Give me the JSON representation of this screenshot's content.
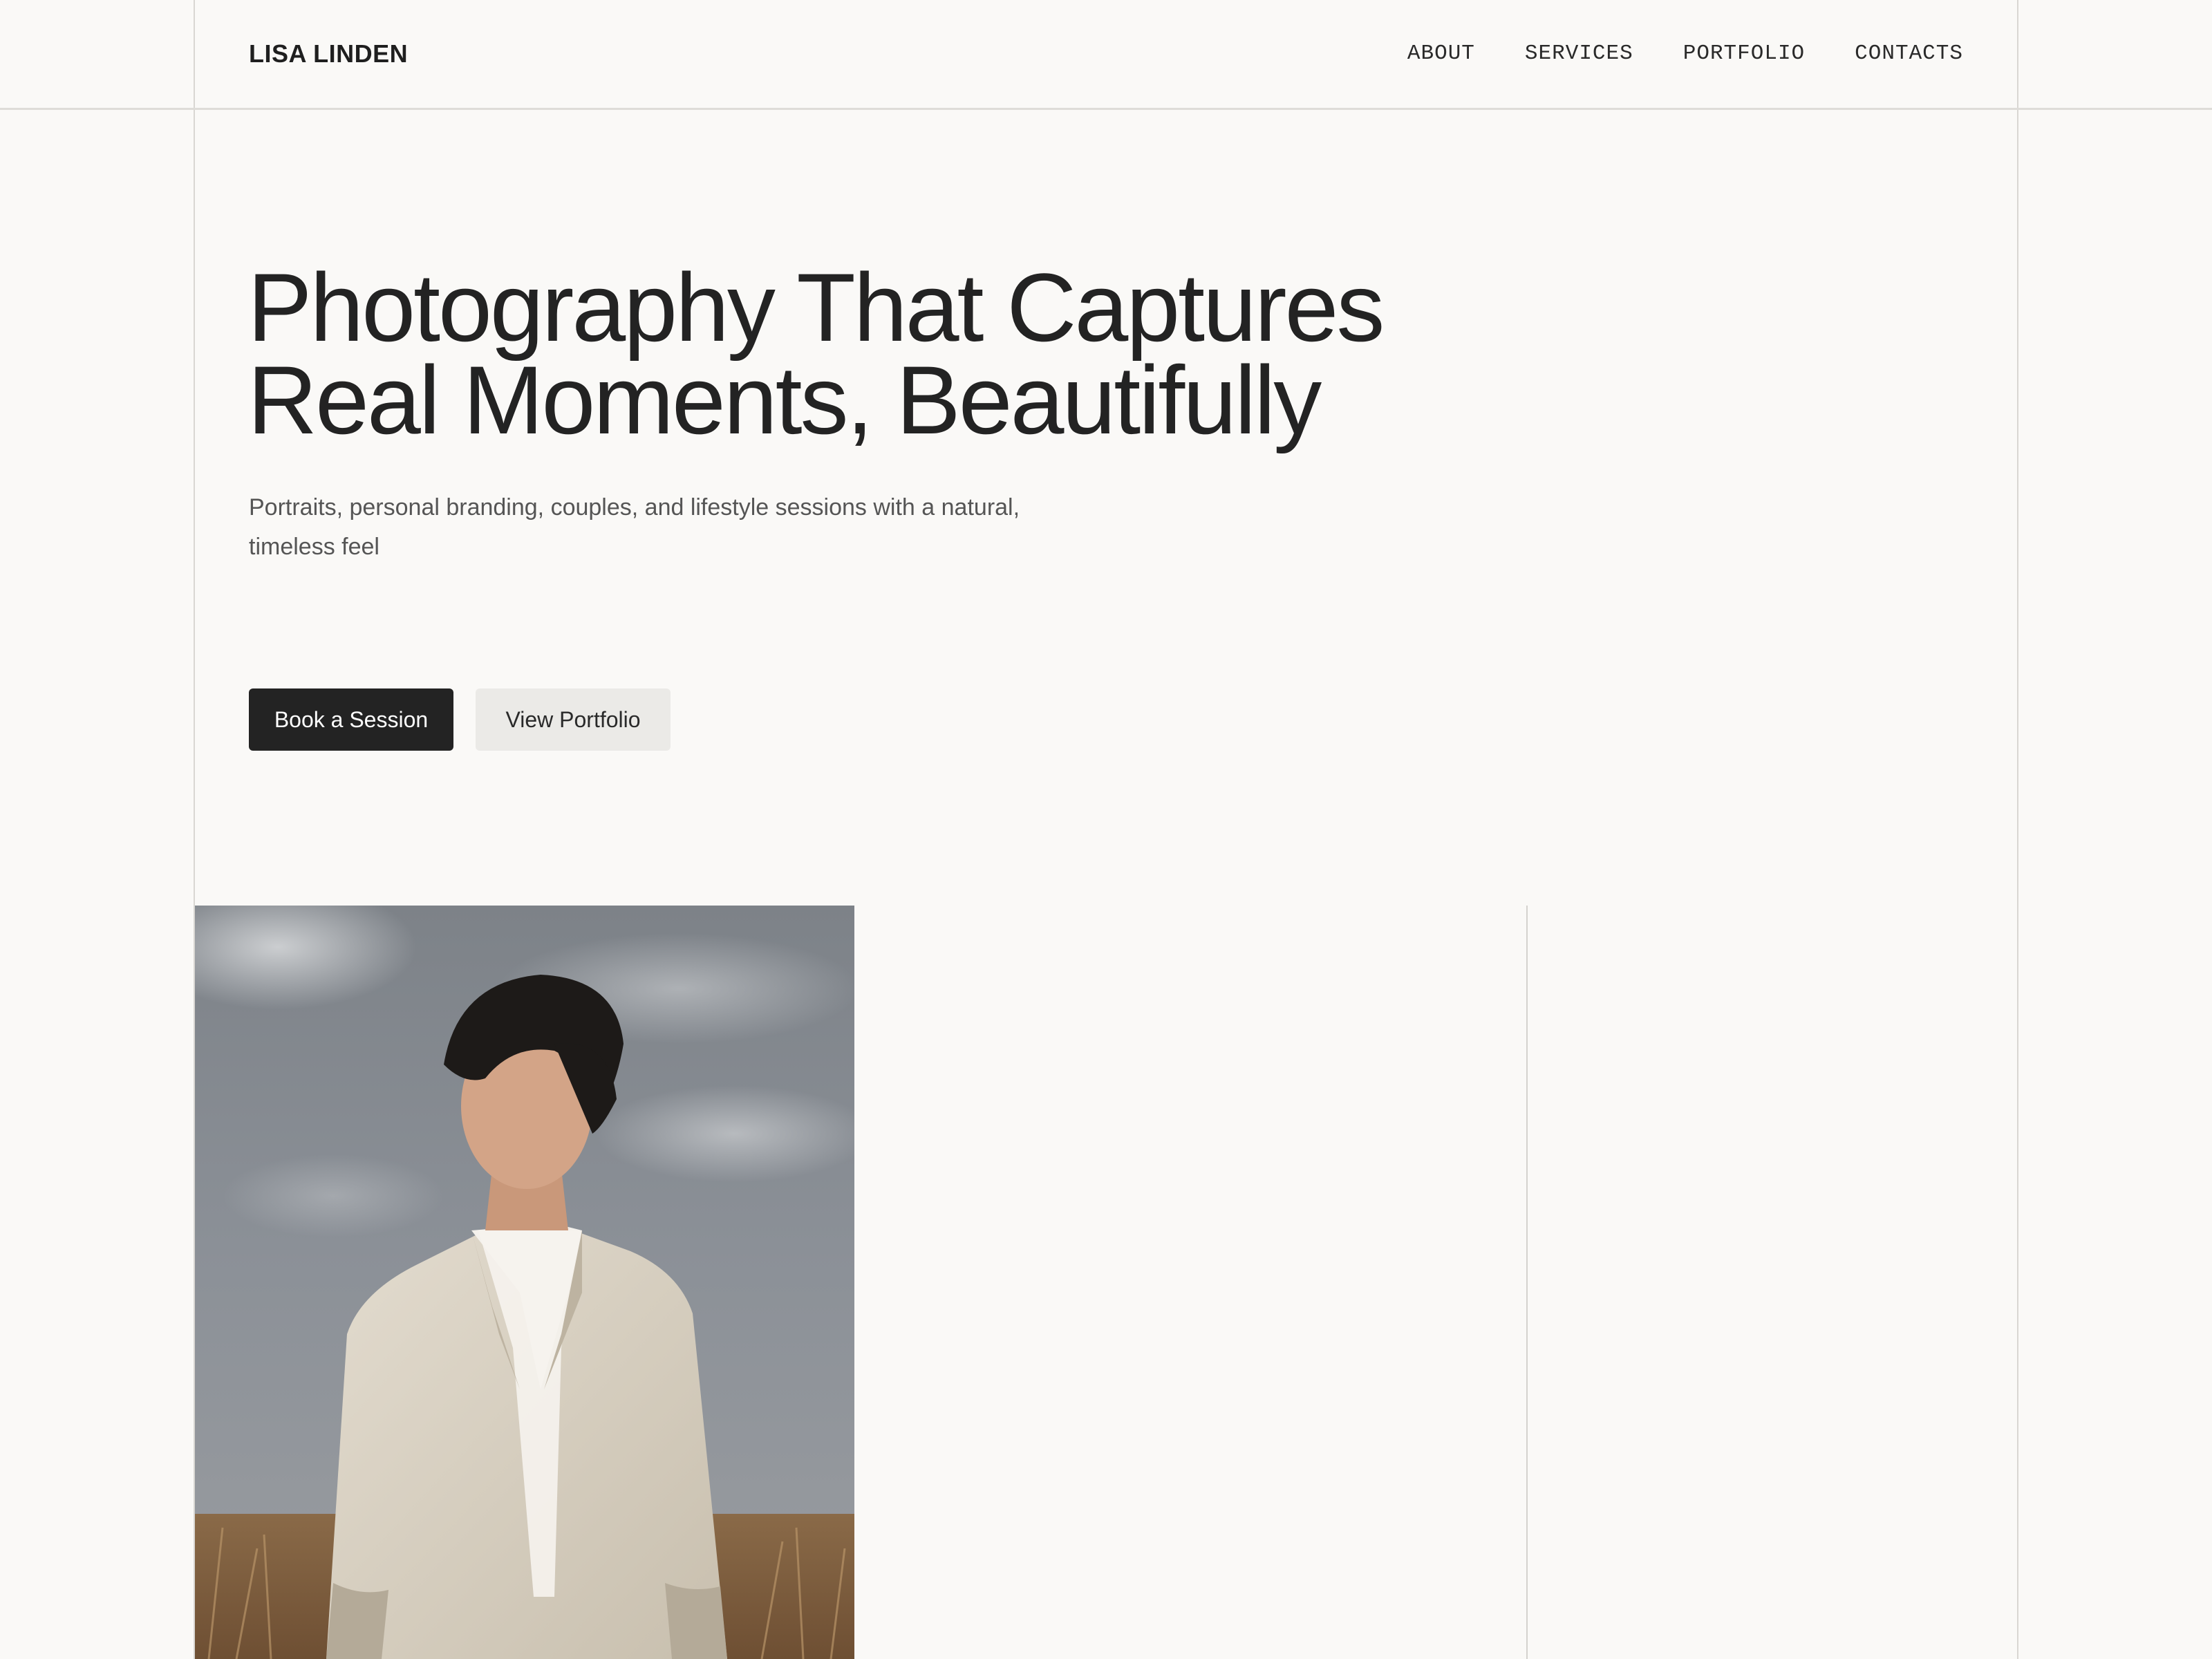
{
  "header": {
    "logo": "LISA LINDEN",
    "nav": [
      {
        "label": "ABOUT"
      },
      {
        "label": "SERVICES"
      },
      {
        "label": "PORTFOLIO"
      },
      {
        "label": "CONTACTS"
      }
    ]
  },
  "hero": {
    "title_line1": "Photography That Captures",
    "title_line2": "Real Moments, Beautifully",
    "subtitle": "Portraits, personal branding, couples, and lifestyle sessions with a natural, timeless feel",
    "primary_button": "Book a Session",
    "secondary_button": "View Portfolio"
  },
  "colors": {
    "background": "#faf9f7",
    "primary_button": "#232323",
    "secondary_button": "#ebeae7",
    "text": "#232323",
    "gridline": "#d9d7d3"
  }
}
